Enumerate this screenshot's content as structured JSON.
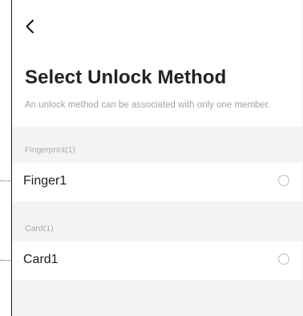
{
  "header": {
    "back_icon": "chevron-left-icon",
    "title": "Select Unlock Method",
    "subtitle": "An unlock method can be associated with only one member."
  },
  "sections": [
    {
      "header": "Fingerprint(1)",
      "items": [
        {
          "label": "Finger1",
          "selected": false
        }
      ]
    },
    {
      "header": "Card(1)",
      "items": [
        {
          "label": "Card1",
          "selected": false
        }
      ]
    }
  ],
  "colors": {
    "background": "#f4f4f4",
    "surface": "#ffffff",
    "title_text": "#222222",
    "secondary_text": "#a3a3a3",
    "radio_border": "#bdbdbd"
  }
}
